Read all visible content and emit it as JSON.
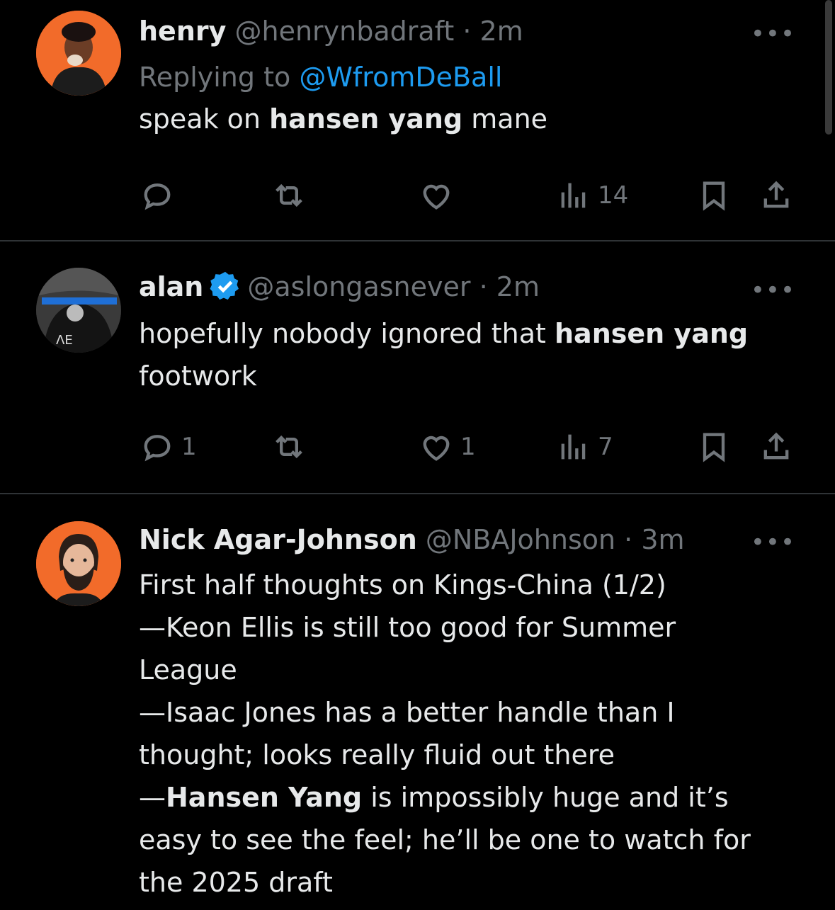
{
  "tweets": [
    {
      "name": "henry",
      "handle": "@henrynbadraft",
      "time": "2m",
      "replying_prefix": "Replying to",
      "replying_handle": "@WfromDeBall",
      "body_lines": [
        [
          {
            "t": "speak on ",
            "b": false
          },
          {
            "t": "hansen yang",
            "b": true
          },
          {
            "t": " mane",
            "b": false
          }
        ]
      ],
      "replies": "",
      "likes": "",
      "views": "14"
    },
    {
      "name": "alan",
      "verified": true,
      "handle": "@aslongasnever",
      "time": "2m",
      "body_lines": [
        [
          {
            "t": "hopefully nobody ignored that ",
            "b": false
          },
          {
            "t": "hansen yang",
            "b": true
          }
        ],
        [
          {
            "t": "footwork",
            "b": false
          }
        ]
      ],
      "replies": "1",
      "likes": "1",
      "views": "7"
    },
    {
      "name": "Nick Agar-Johnson",
      "handle": "@NBAJohnson",
      "time": "3m",
      "body_lines": [
        [
          {
            "t": "First half thoughts on Kings-China (1/2)",
            "b": false
          }
        ],
        [
          {
            "t": "—Keon Ellis is still too good for Summer",
            "b": false
          }
        ],
        [
          {
            "t": "League",
            "b": false
          }
        ],
        [
          {
            "t": "—Isaac Jones has a better handle than I",
            "b": false
          }
        ],
        [
          {
            "t": "thought; looks really fluid out there",
            "b": false
          }
        ],
        [
          {
            "t": "—",
            "b": false
          },
          {
            "t": "Hansen Yang",
            "b": true
          },
          {
            "t": " is impossibly huge and it’s",
            "b": false
          }
        ],
        [
          {
            "t": "easy to see the feel; he’ll be one to watch for",
            "b": false
          }
        ],
        [
          {
            "t": "the 2025 draft",
            "b": false
          }
        ]
      ]
    }
  ],
  "separator": " · ",
  "more_glyph": "•••",
  "colors": {
    "accent": "#1d9bf0",
    "muted": "#71767b",
    "text": "#e7e9ea",
    "divider": "#2f3336",
    "avatar_orange": "#f26b2a"
  },
  "icons": [
    "reply-icon",
    "retweet-icon",
    "like-icon",
    "views-icon",
    "bookmark-icon",
    "share-icon",
    "verified-badge-icon",
    "more-icon"
  ]
}
